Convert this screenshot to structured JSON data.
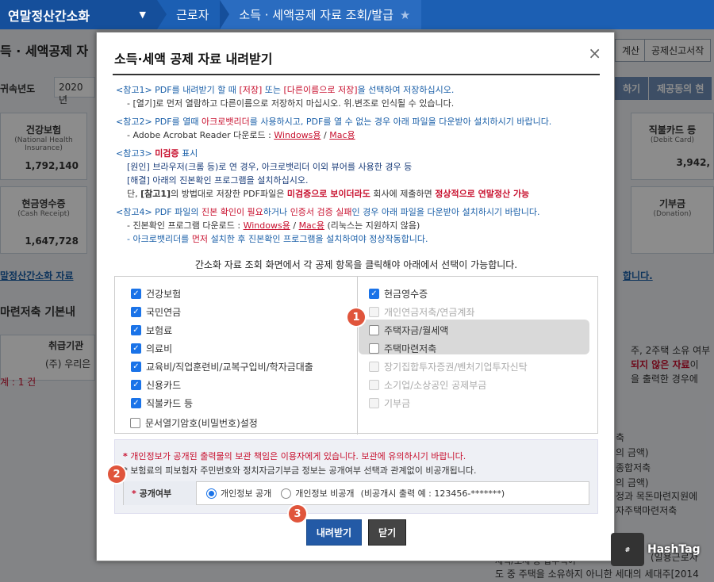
{
  "topnav": {
    "brand": "연말정산간소화",
    "crumb1": "근로자",
    "crumb2": "소득 · 세액공제 자료 조회/발급"
  },
  "background": {
    "page_title": "득 · 세액공제 자",
    "year_label": "귀속년도",
    "year_value": "2020년",
    "btn_calc": "계산",
    "btn_report": "공제신고서작",
    "btn_view": "하기",
    "btn_provide": "제공동의 현",
    "card1_title": "건강보험",
    "card1_sub": "(National Health Insurance)",
    "card1_value": "1,792,140",
    "card2_title": "직불카드 등",
    "card2_sub": "(Debit Card)",
    "card2_value": "3,942,",
    "card3_title": "현금영수증",
    "card3_sub": "(Cash Receipt)",
    "card3_value": "1,647,728",
    "card4_title": "기부금",
    "card4_sub": "(Donation)",
    "link_left": "말정산간소화 자료",
    "link_right": "합니다.",
    "section_title": "마련저축 기본내",
    "col_header": "취급기관",
    "row_value": "(주) 우리은",
    "count_label": "계 : 1 건",
    "right_text1": "주, 2주택 소유 여부",
    "right_text2": "되지 않은 자료",
    "right_text2b": "이",
    "right_text3": "을 출력한 경우에",
    "right_list1": "축",
    "right_list2": "의 금액)",
    "right_list3": "종합저축",
    "right_list4": "의 금액)",
    "right_list5": "정과 목돈마련지원에",
    "right_list6": "자주택마련저축",
    "bottom1": "(일용근로자",
    "bottom2": "재직/조세 등 납부액이",
    "bottom3": "도 중 주택을 소유하지 아니한 세대의 세대주[2014"
  },
  "modal": {
    "title": "소득·세액 공제 자료 내려받기",
    "close": "×",
    "ref1_head": "<참고1> PDF를 내려받기 할 때",
    "ref1_save": "[저장]",
    "ref1_or": "또는",
    "ref1_saveas": "[다른이름으로 저장]",
    "ref1_tail": "을 선택하여 저장하십시오.",
    "ref1_line2": "- [열기]로 먼저 열람하고 다른이름으로 저장하지 마십시오. 위.변조로 인식될 수 있습니다.",
    "ref2_head": "<참고2> PDF를 열때",
    "ref2_reader": "아크로뱃리더",
    "ref2_tail": "를 사용하시고, PDF를 열 수 없는 경우 아래 파일을 다운받아 설치하시기 바랍니다.",
    "ref2_line2": "- Adobe Acrobat Reader 다운로드 :",
    "ref2_win": "Windows용",
    "ref2_sep": "/",
    "ref2_mac": "Mac용",
    "ref3_head": "<참고3>",
    "ref3_mark": "미검증",
    "ref3_tail": "표시",
    "ref3_cause": "[원인] 브라우저(크롬 등)로 연 경우, 아크로뱃리더 이외 뷰어를 사용한 경우 등",
    "ref3_fix": "[해결] 아래의 진본확인 프로그램을 설치하십시오.",
    "ref3_line3a": "단,",
    "ref3_line3b": "[참고1]",
    "ref3_line3c": "의 방법대로 저장한 PDF파일은",
    "ref3_line3d": "미검증으로 보이더라도",
    "ref3_line3e": "회사에 제출하면",
    "ref3_line3f": "정상적으로 연말정산 가능",
    "ref4_head": "<참고4> PDF 파일의",
    "ref4_need": "진본 확인이 필요",
    "ref4_mid": "하거나",
    "ref4_fail": "인증서 검증 실패",
    "ref4_tail": "인 경우 아래 파일을 다운받아 설치하시기 바랍니다.",
    "ref4_line2": "- 진본확인 프로그램 다운로드 :",
    "ref4_win": "Windows용",
    "ref4_sep": "/",
    "ref4_mac": "Mac용",
    "ref4_note": "(리눅스는 지원하지 않음)",
    "ref4_line3a": "- 아크로뱃리더를",
    "ref4_line3b": "먼저",
    "ref4_line3c": "설치한 후 진본확인 프로그램을 설치하여야 정상작동합니다.",
    "guide": "간소화 자료 조회 화면에서 각 공제 항목을 클릭해야 아래에서 선택이 가능합니다.",
    "left_items": [
      {
        "label": "건강보험",
        "checked": true
      },
      {
        "label": "국민연금",
        "checked": true
      },
      {
        "label": "보험료",
        "checked": true
      },
      {
        "label": "의료비",
        "checked": true
      },
      {
        "label": "교육비/직업훈련비/교복구입비/학자금대출",
        "checked": true
      },
      {
        "label": "신용카드",
        "checked": true
      },
      {
        "label": "직불카드 등",
        "checked": true
      }
    ],
    "right_items": [
      {
        "label": "현금영수증",
        "checked": true,
        "disabled": false
      },
      {
        "label": "개인연금저축/연금계좌",
        "checked": false,
        "disabled": true
      },
      {
        "label": "주택자금/월세액",
        "checked": false,
        "disabled": false
      },
      {
        "label": "주택마련저축",
        "checked": false,
        "disabled": false
      },
      {
        "label": "장기집합투자증권/벤처기업투자신탁",
        "checked": false,
        "disabled": true
      },
      {
        "label": "소기업/소상공인 공제부금",
        "checked": false,
        "disabled": true
      },
      {
        "label": "기부금",
        "checked": false,
        "disabled": true
      }
    ],
    "password_label": "문서열기암호(비밀번호)설정",
    "privacy_note1": "개인정보가 공개된 출력물의 보관 책임은 이용자에게 있습니다. 보관에 유의하시기 바랍니다.",
    "privacy_note2": "보험료의 피보험자 주민번호와 정치자금기부금 정보는 공개여부 선택과 관계없이 비공개됩니다.",
    "bullet": "*",
    "pub_label": "공개여부",
    "opt_public": "개인정보 공개",
    "opt_private": "개인정보 비공개",
    "opt_example": "(비공개시 출력 예 : 123456-*******)",
    "download_btn": "내려받기",
    "close_btn": "닫기",
    "badges": [
      "1",
      "2",
      "3"
    ]
  },
  "watermark": "HashTag",
  "colors": {
    "nav": "#1c5fb3",
    "accent_red": "#c8102e",
    "link_blue": "#1a5fa8",
    "badge": "#e0553c",
    "check": "#1a73e8"
  }
}
